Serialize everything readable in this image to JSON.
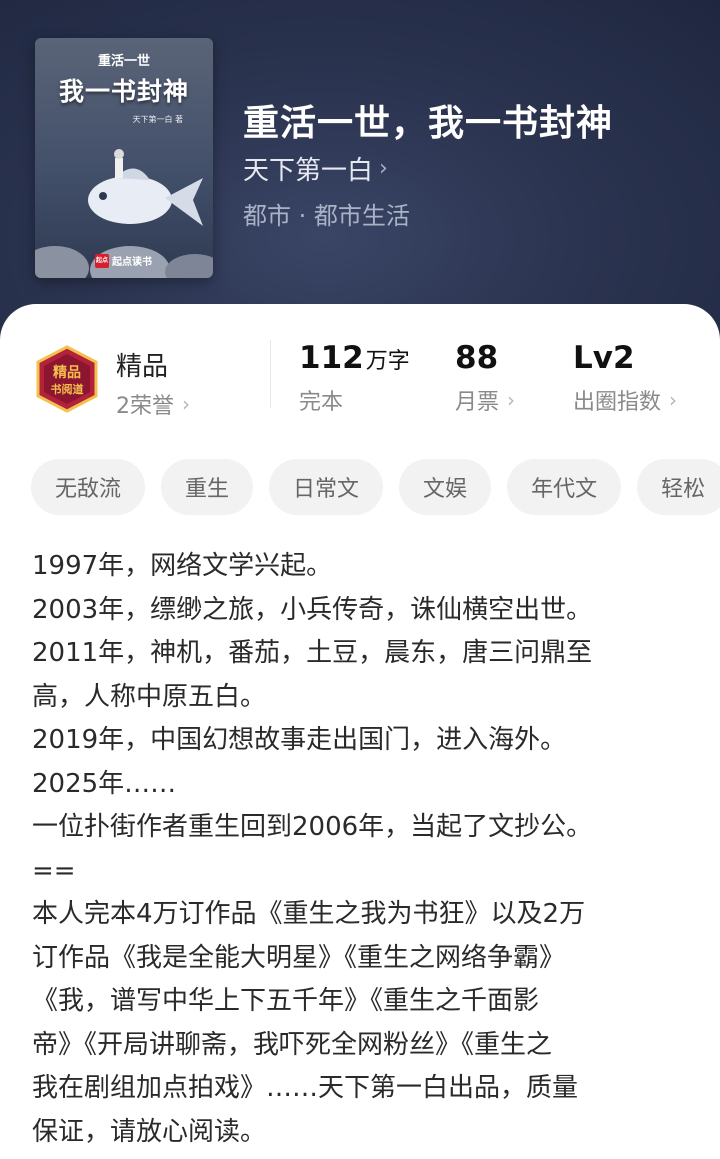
{
  "cover": {
    "subtitle": "重活一世",
    "title": "我一书封神",
    "author": "天下第一白 著",
    "brand": "起点读书",
    "brand_mark": "起点"
  },
  "book": {
    "title": "重活一世，我一书封神",
    "author": "天下第一白",
    "genre": "都市 · 都市生活"
  },
  "honor": {
    "label": "精品",
    "count": "2荣誉",
    "badge_text_1": "精品",
    "badge_text_2": "书阅道"
  },
  "stats": {
    "words_value": "112",
    "words_unit": "万字",
    "words_label": "完本",
    "votes_value": "88",
    "votes_label": "月票",
    "level_value": "Lv2",
    "level_label": "出圈指数"
  },
  "tags": [
    "无敌流",
    "重生",
    "日常文",
    "文娱",
    "年代文",
    "轻松"
  ],
  "synopsis": [
    "1997年，网络文学兴起。",
    "2003年，缥缈之旅，小兵传奇，诛仙横空出世。",
    "2011年，神机，番茄，土豆，晨东，唐三问鼎至\n高，人称中原五白。",
    "2019年，中国幻想故事走出国门，进入海外。",
    "2025年……",
    "一位扑街作者重生回到2006年，当起了文抄公。",
    "==",
    "本人完本4万订作品《重生之我为书狂》以及2万\n订作品《我是全能大明星》《重生之网络争霸》\n《我，谱写中华上下五千年》《重生之千面影\n帝》《开局讲聊斋，我吓死全网粉丝》《重生之\n我在剧组加点拍戏》……天下第一白出品，质量\n保证，请放心阅读。"
  ],
  "colors": {
    "hero_bg": "#2b3450",
    "sheet_bg": "#ffffff",
    "tag_bg": "#f2f2f2",
    "badge_red": "#b3213a",
    "badge_gold": "#f2c14e"
  }
}
